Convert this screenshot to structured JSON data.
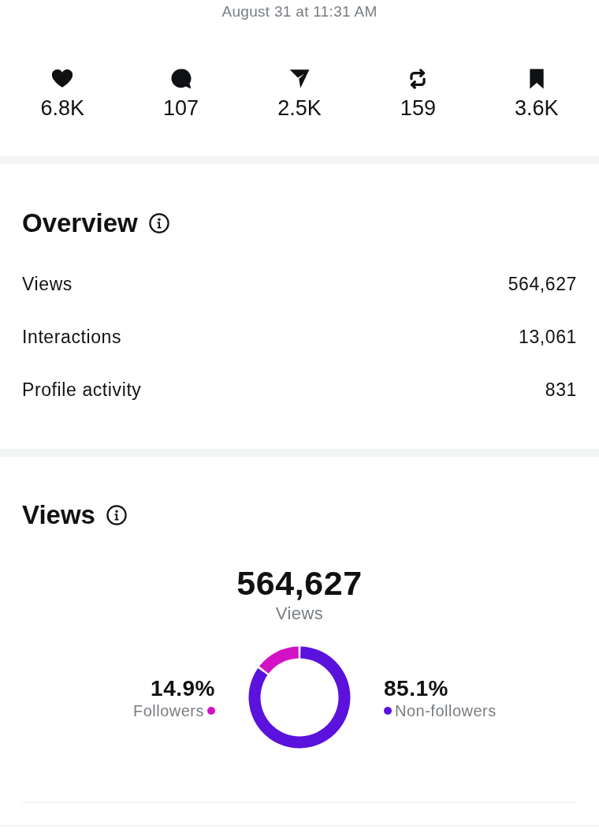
{
  "timestamp": "August 31 at 11:31 AM",
  "stats": [
    {
      "kind": "like",
      "count": "6.8K"
    },
    {
      "kind": "comment",
      "count": "107"
    },
    {
      "kind": "share",
      "count": "2.5K"
    },
    {
      "kind": "repost",
      "count": "159"
    },
    {
      "kind": "save",
      "count": "3.6K"
    }
  ],
  "overview": {
    "title": "Overview",
    "rows": [
      {
        "label": "Views",
        "value": "564,627"
      },
      {
        "label": "Interactions",
        "value": "13,061"
      },
      {
        "label": "Profile activity",
        "value": "831"
      }
    ]
  },
  "views": {
    "title": "Views",
    "total": "564,627",
    "total_label": "Views",
    "legend": [
      {
        "percent": "14.9%",
        "color": "#d212c4"
      },
      {
        "percent": "85.1%",
        "color": "#5b12dc"
      }
    ],
    "chart_data": {
      "type": "donut",
      "categories": [
        "Followers",
        "Non-followers"
      ],
      "values": [
        14.9,
        85.1
      ]
    }
  }
}
